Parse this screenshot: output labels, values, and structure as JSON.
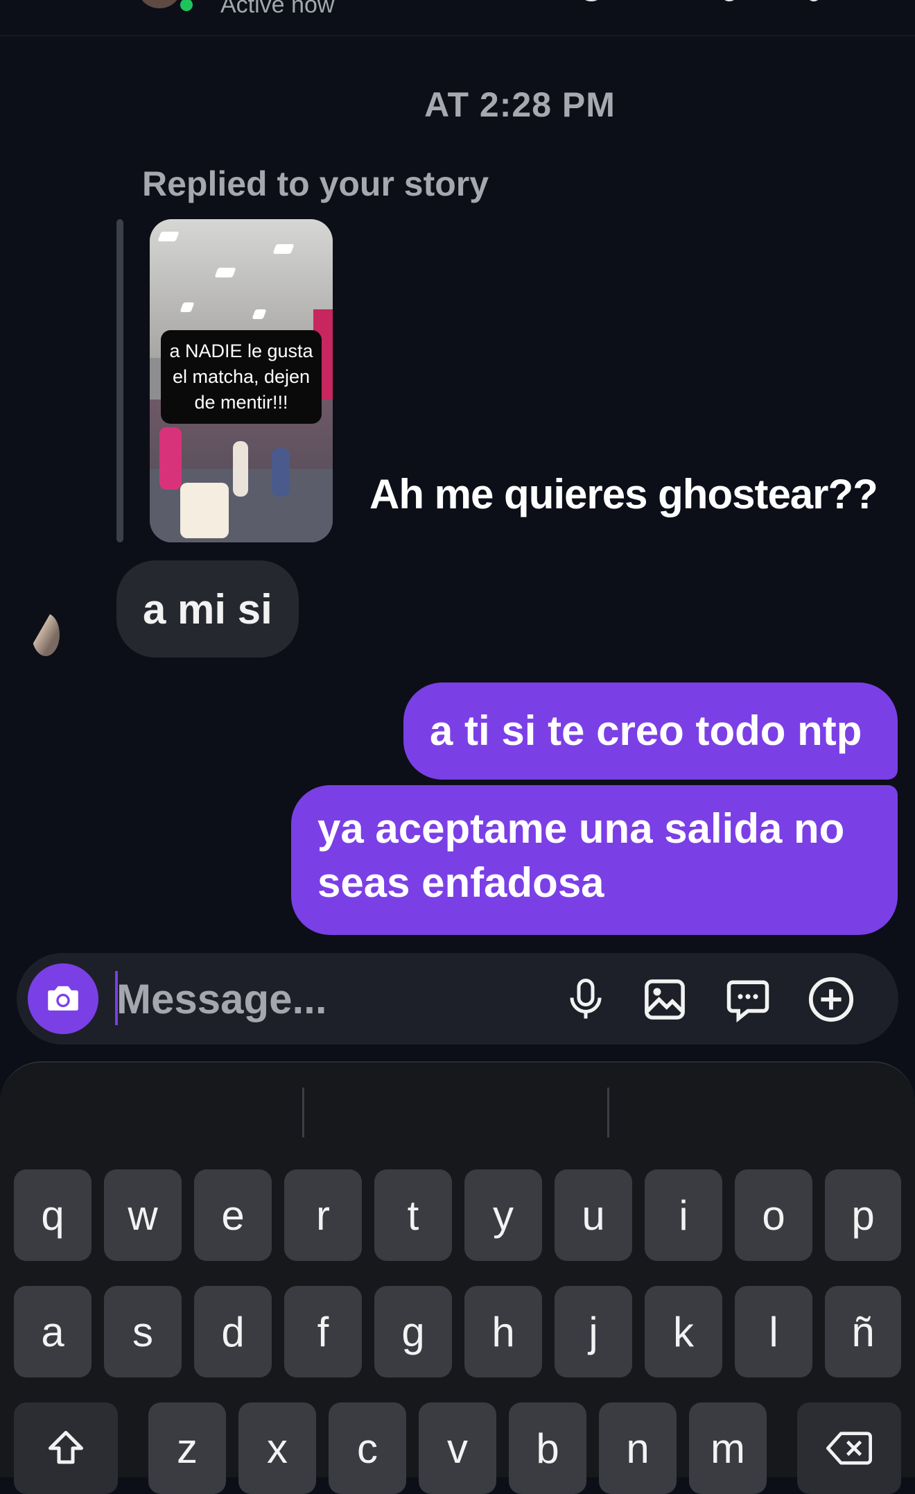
{
  "header": {
    "status": "Active now"
  },
  "thread": {
    "timestamp": "AT 2:28 PM",
    "story_reply": {
      "label": "Replied to your story",
      "story_caption": "a NADIE le gusta el matcha, dejen de mentir!!!",
      "reply_text": "Ah me quieres ghostear??"
    },
    "messages": [
      {
        "from": "them",
        "text": "a mi si"
      },
      {
        "from": "me",
        "text": "a ti si te creo todo ntp"
      },
      {
        "from": "me",
        "text": "ya aceptame una salida no seas enfadosa"
      }
    ]
  },
  "composer": {
    "placeholder": "Message...",
    "icons": [
      "camera-icon",
      "microphone-icon",
      "gallery-icon",
      "sticker-chat-icon",
      "plus-circle-icon"
    ]
  },
  "keyboard": {
    "row1": [
      "q",
      "w",
      "e",
      "r",
      "t",
      "y",
      "u",
      "i",
      "o",
      "p"
    ],
    "row2": [
      "a",
      "s",
      "d",
      "f",
      "g",
      "h",
      "j",
      "k",
      "l",
      "ñ"
    ],
    "row3": [
      "z",
      "x",
      "c",
      "v",
      "b",
      "n",
      "m"
    ]
  },
  "colors": {
    "background": "#0c0f17",
    "accent": "#7b3fe6",
    "incoming_bubble": "#25282f",
    "online": "#1fc35c"
  }
}
